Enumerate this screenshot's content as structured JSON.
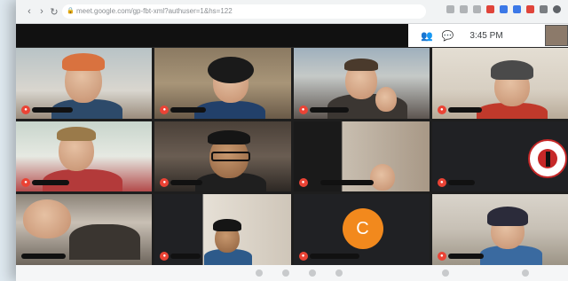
{
  "browser": {
    "url": "meet.google.com/gp-fbt-xml?authuser=1&hs=122",
    "back_glyph": "‹",
    "forward_glyph": "›",
    "reload_glyph": "↻",
    "lock_glyph": "🔒"
  },
  "meet_controls": {
    "people_glyph": "👥",
    "chat_glyph": "💬",
    "time": "3:45 PM"
  },
  "tiles": [
    {
      "name": "participant-tile-1"
    },
    {
      "name": "participant-tile-2"
    },
    {
      "name": "participant-tile-3"
    },
    {
      "name": "participant-tile-4"
    },
    {
      "name": "participant-tile-5"
    },
    {
      "name": "participant-tile-6"
    },
    {
      "name": "participant-tile-7"
    },
    {
      "name": "participant-tile-8"
    },
    {
      "name": "participant-tile-9"
    },
    {
      "name": "participant-tile-10"
    },
    {
      "name": "participant-tile-11"
    },
    {
      "name": "participant-tile-12"
    }
  ],
  "avatar_letter": "C",
  "colors": {
    "mic_muted": "#ea4335",
    "avatar_orange": "#f2891d",
    "logo_red": "#c62828"
  }
}
